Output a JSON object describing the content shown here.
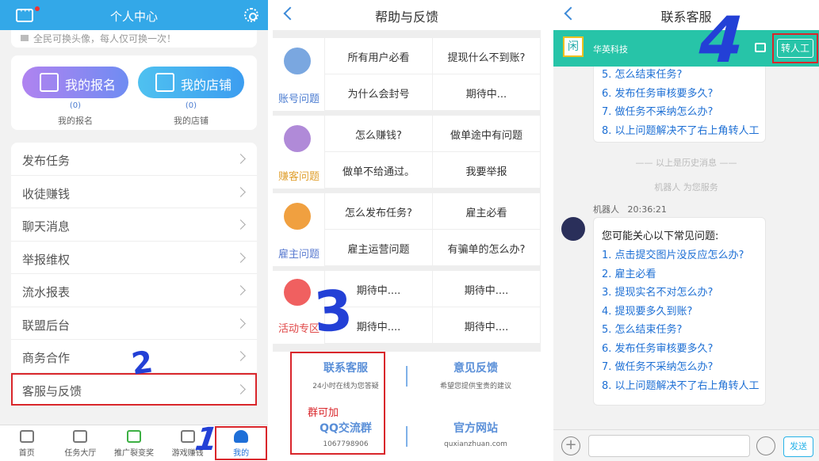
{
  "profile": {
    "title": "个人中心",
    "notice": "全民可换头像，每人仅可换一次！",
    "cards": [
      {
        "label": "我的报名",
        "count": "(0)",
        "caption": "我的报名"
      },
      {
        "label": "我的店铺",
        "count": "(0)",
        "caption": "我的店铺"
      }
    ],
    "menu": [
      "发布任务",
      "收徒赚钱",
      "聊天消息",
      "举报维权",
      "流水报表",
      "联盟后台",
      "商务合作",
      "客服与反馈"
    ],
    "tabs": [
      "首页",
      "任务大厅",
      "推广裂变奖",
      "游戏赚钱",
      "我的"
    ],
    "annotation_2": "2",
    "annotation_1": "1"
  },
  "help": {
    "title": "帮助与反馈",
    "sections": [
      {
        "label": "账号问题",
        "color": "#4a7bd0",
        "items": [
          "所有用户必看",
          "提现什么不到账?",
          "为什么会封号",
          "期待中..."
        ]
      },
      {
        "label": "赚客问题",
        "color": "#e0a030",
        "items": [
          "怎么赚钱?",
          "做单途中有问题",
          "做单不给通过。",
          "我要举报"
        ]
      },
      {
        "label": "雇主问题",
        "color": "#5a7bd0",
        "items": [
          "怎么发布任务?",
          "雇主必看",
          "雇主运营问题",
          "有骗单的怎么办?"
        ]
      },
      {
        "label": "活动专区",
        "color": "#e04848",
        "items": [
          "期待中....",
          "期待中....",
          "期待中....",
          "期待中...."
        ]
      }
    ],
    "contact": {
      "title": "联系客服",
      "sub": "24小时在线为您答疑"
    },
    "feedback": {
      "title": "意见反馈",
      "sub": "希望您提供宝贵的建议"
    },
    "qq": {
      "title": "QQ交流群",
      "sub": "1067798906",
      "note": "群可加"
    },
    "site": {
      "title": "官方网站",
      "sub": "quxianzhuan.com"
    },
    "annotation_3": "3"
  },
  "chat": {
    "title": "联系客服",
    "company": "华英科技",
    "logo_char": "闲",
    "transfer": "转人工",
    "history_tail": [
      "5. 怎么结束任务?",
      "6. 发布任务审核要多久?",
      "7. 做任务不采纳怎么办?",
      "8. 以上问题解决不了右上角转人工"
    ],
    "history_divider": "—— 以上是历史消息 ——",
    "service_note": "机器人 为您服务",
    "sender": "机器人",
    "time": "20:36:21",
    "intro": "您可能关心以下常见问题:",
    "questions": [
      "1. 点击提交图片没反应怎么办?",
      "2. 雇主必看",
      "3. 提现实名不对怎么办?",
      "4. 提现要多久到账?",
      "5. 怎么结束任务?",
      "6. 发布任务审核要多久?",
      "7. 做任务不采纳怎么办?",
      "8. 以上问题解决不了右上角转人工"
    ],
    "send": "发送",
    "annotation_4": "4"
  }
}
